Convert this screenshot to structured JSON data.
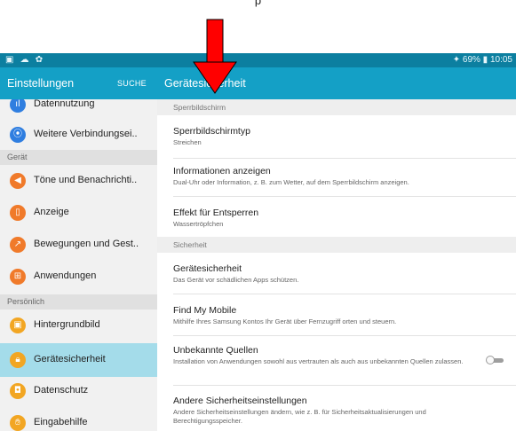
{
  "annotation": {
    "text": "p"
  },
  "status_bar": {
    "left_icons": "▣ ☁ ✿",
    "right_text": "✦ 69% ▮ 10:05"
  },
  "sidebar_header": {
    "title": "Einstellungen",
    "search_label": "SUCHE"
  },
  "content_header": {
    "title": "Gerätesicherheit"
  },
  "sidebar": {
    "items": [
      {
        "label": "Datennutzung",
        "icon": "data-usage-icon",
        "color": "#2f7ee0"
      },
      {
        "label": "Weitere Verbindungsei..",
        "icon": "more-connections-icon",
        "color": "#2f7ee0"
      },
      {
        "label": "Töne und Benachrichti..",
        "icon": "sound-icon",
        "color": "#f07a2a"
      },
      {
        "label": "Anzeige",
        "icon": "display-icon",
        "color": "#f07a2a"
      },
      {
        "label": "Bewegungen und Gest..",
        "icon": "motion-icon",
        "color": "#f07a2a"
      },
      {
        "label": "Anwendungen",
        "icon": "apps-icon",
        "color": "#f07a2a"
      },
      {
        "label": "Hintergrundbild",
        "icon": "wallpaper-icon",
        "color": "#f2a623"
      },
      {
        "label": "Gerätesicherheit",
        "icon": "lock-icon",
        "color": "#f2a623"
      },
      {
        "label": "Datenschutz",
        "icon": "privacy-icon",
        "color": "#f2a623"
      },
      {
        "label": "Eingabehilfe",
        "icon": "accessibility-icon",
        "color": "#f2a623"
      }
    ],
    "sections": {
      "device": "Gerät",
      "personal": "Persönlich"
    }
  },
  "content": {
    "sections": {
      "lock_screen": "Sperrbildschirm",
      "security": "Sicherheit"
    },
    "items": [
      {
        "title": "Sperrbildschirmtyp",
        "subtitle": "Streichen"
      },
      {
        "title": "Informationen anzeigen",
        "subtitle": "Dual-Uhr oder Information, z. B. zum Wetter, auf dem Sperrbildschirm anzeigen."
      },
      {
        "title": "Effekt für Entsperren",
        "subtitle": "Wassertröpfchen"
      },
      {
        "title": "Gerätesicherheit",
        "subtitle": "Das Gerät vor schädlichen Apps schützen."
      },
      {
        "title": "Find My Mobile",
        "subtitle": "Mithilfe Ihres Samsung Kontos Ihr Gerät über Fernzugriff orten und steuern."
      },
      {
        "title": "Unbekannte Quellen",
        "subtitle": "Installation von Anwendungen sowohl aus vertrauten als auch aus unbekannten Quellen zulassen.",
        "toggle_state": "off"
      },
      {
        "title": "Andere Sicherheitseinstellungen",
        "subtitle": "Andere Sicherheitseinstellungen ändern, wie z. B. für Sicherheitsaktualisierungen und Berechtigungsspeicher."
      }
    ]
  },
  "colors": {
    "header": "#14a0c6",
    "status_bar": "#0c7fa0",
    "active_item": "#a4dcea",
    "arrow": "#ff0000"
  }
}
